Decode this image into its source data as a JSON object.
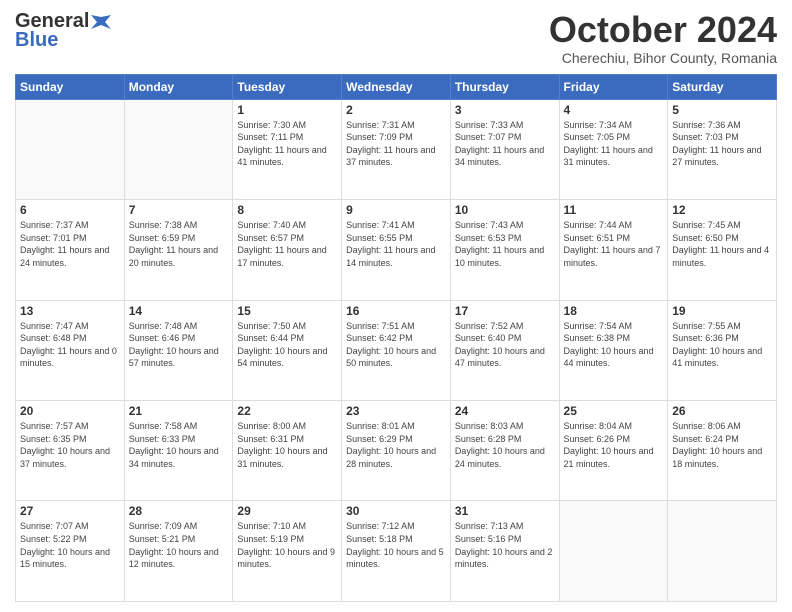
{
  "header": {
    "logo_general": "General",
    "logo_blue": "Blue",
    "month_title": "October 2024",
    "subtitle": "Cherechiu, Bihor County, Romania"
  },
  "days_of_week": [
    "Sunday",
    "Monday",
    "Tuesday",
    "Wednesday",
    "Thursday",
    "Friday",
    "Saturday"
  ],
  "weeks": [
    [
      {
        "day": "",
        "sunrise": "",
        "sunset": "",
        "daylight": ""
      },
      {
        "day": "",
        "sunrise": "",
        "sunset": "",
        "daylight": ""
      },
      {
        "day": "1",
        "sunrise": "Sunrise: 7:30 AM",
        "sunset": "Sunset: 7:11 PM",
        "daylight": "Daylight: 11 hours and 41 minutes."
      },
      {
        "day": "2",
        "sunrise": "Sunrise: 7:31 AM",
        "sunset": "Sunset: 7:09 PM",
        "daylight": "Daylight: 11 hours and 37 minutes."
      },
      {
        "day": "3",
        "sunrise": "Sunrise: 7:33 AM",
        "sunset": "Sunset: 7:07 PM",
        "daylight": "Daylight: 11 hours and 34 minutes."
      },
      {
        "day": "4",
        "sunrise": "Sunrise: 7:34 AM",
        "sunset": "Sunset: 7:05 PM",
        "daylight": "Daylight: 11 hours and 31 minutes."
      },
      {
        "day": "5",
        "sunrise": "Sunrise: 7:36 AM",
        "sunset": "Sunset: 7:03 PM",
        "daylight": "Daylight: 11 hours and 27 minutes."
      }
    ],
    [
      {
        "day": "6",
        "sunrise": "Sunrise: 7:37 AM",
        "sunset": "Sunset: 7:01 PM",
        "daylight": "Daylight: 11 hours and 24 minutes."
      },
      {
        "day": "7",
        "sunrise": "Sunrise: 7:38 AM",
        "sunset": "Sunset: 6:59 PM",
        "daylight": "Daylight: 11 hours and 20 minutes."
      },
      {
        "day": "8",
        "sunrise": "Sunrise: 7:40 AM",
        "sunset": "Sunset: 6:57 PM",
        "daylight": "Daylight: 11 hours and 17 minutes."
      },
      {
        "day": "9",
        "sunrise": "Sunrise: 7:41 AM",
        "sunset": "Sunset: 6:55 PM",
        "daylight": "Daylight: 11 hours and 14 minutes."
      },
      {
        "day": "10",
        "sunrise": "Sunrise: 7:43 AM",
        "sunset": "Sunset: 6:53 PM",
        "daylight": "Daylight: 11 hours and 10 minutes."
      },
      {
        "day": "11",
        "sunrise": "Sunrise: 7:44 AM",
        "sunset": "Sunset: 6:51 PM",
        "daylight": "Daylight: 11 hours and 7 minutes."
      },
      {
        "day": "12",
        "sunrise": "Sunrise: 7:45 AM",
        "sunset": "Sunset: 6:50 PM",
        "daylight": "Daylight: 11 hours and 4 minutes."
      }
    ],
    [
      {
        "day": "13",
        "sunrise": "Sunrise: 7:47 AM",
        "sunset": "Sunset: 6:48 PM",
        "daylight": "Daylight: 11 hours and 0 minutes."
      },
      {
        "day": "14",
        "sunrise": "Sunrise: 7:48 AM",
        "sunset": "Sunset: 6:46 PM",
        "daylight": "Daylight: 10 hours and 57 minutes."
      },
      {
        "day": "15",
        "sunrise": "Sunrise: 7:50 AM",
        "sunset": "Sunset: 6:44 PM",
        "daylight": "Daylight: 10 hours and 54 minutes."
      },
      {
        "day": "16",
        "sunrise": "Sunrise: 7:51 AM",
        "sunset": "Sunset: 6:42 PM",
        "daylight": "Daylight: 10 hours and 50 minutes."
      },
      {
        "day": "17",
        "sunrise": "Sunrise: 7:52 AM",
        "sunset": "Sunset: 6:40 PM",
        "daylight": "Daylight: 10 hours and 47 minutes."
      },
      {
        "day": "18",
        "sunrise": "Sunrise: 7:54 AM",
        "sunset": "Sunset: 6:38 PM",
        "daylight": "Daylight: 10 hours and 44 minutes."
      },
      {
        "day": "19",
        "sunrise": "Sunrise: 7:55 AM",
        "sunset": "Sunset: 6:36 PM",
        "daylight": "Daylight: 10 hours and 41 minutes."
      }
    ],
    [
      {
        "day": "20",
        "sunrise": "Sunrise: 7:57 AM",
        "sunset": "Sunset: 6:35 PM",
        "daylight": "Daylight: 10 hours and 37 minutes."
      },
      {
        "day": "21",
        "sunrise": "Sunrise: 7:58 AM",
        "sunset": "Sunset: 6:33 PM",
        "daylight": "Daylight: 10 hours and 34 minutes."
      },
      {
        "day": "22",
        "sunrise": "Sunrise: 8:00 AM",
        "sunset": "Sunset: 6:31 PM",
        "daylight": "Daylight: 10 hours and 31 minutes."
      },
      {
        "day": "23",
        "sunrise": "Sunrise: 8:01 AM",
        "sunset": "Sunset: 6:29 PM",
        "daylight": "Daylight: 10 hours and 28 minutes."
      },
      {
        "day": "24",
        "sunrise": "Sunrise: 8:03 AM",
        "sunset": "Sunset: 6:28 PM",
        "daylight": "Daylight: 10 hours and 24 minutes."
      },
      {
        "day": "25",
        "sunrise": "Sunrise: 8:04 AM",
        "sunset": "Sunset: 6:26 PM",
        "daylight": "Daylight: 10 hours and 21 minutes."
      },
      {
        "day": "26",
        "sunrise": "Sunrise: 8:06 AM",
        "sunset": "Sunset: 6:24 PM",
        "daylight": "Daylight: 10 hours and 18 minutes."
      }
    ],
    [
      {
        "day": "27",
        "sunrise": "Sunrise: 7:07 AM",
        "sunset": "Sunset: 5:22 PM",
        "daylight": "Daylight: 10 hours and 15 minutes."
      },
      {
        "day": "28",
        "sunrise": "Sunrise: 7:09 AM",
        "sunset": "Sunset: 5:21 PM",
        "daylight": "Daylight: 10 hours and 12 minutes."
      },
      {
        "day": "29",
        "sunrise": "Sunrise: 7:10 AM",
        "sunset": "Sunset: 5:19 PM",
        "daylight": "Daylight: 10 hours and 9 minutes."
      },
      {
        "day": "30",
        "sunrise": "Sunrise: 7:12 AM",
        "sunset": "Sunset: 5:18 PM",
        "daylight": "Daylight: 10 hours and 5 minutes."
      },
      {
        "day": "31",
        "sunrise": "Sunrise: 7:13 AM",
        "sunset": "Sunset: 5:16 PM",
        "daylight": "Daylight: 10 hours and 2 minutes."
      },
      {
        "day": "",
        "sunrise": "",
        "sunset": "",
        "daylight": ""
      },
      {
        "day": "",
        "sunrise": "",
        "sunset": "",
        "daylight": ""
      }
    ]
  ]
}
